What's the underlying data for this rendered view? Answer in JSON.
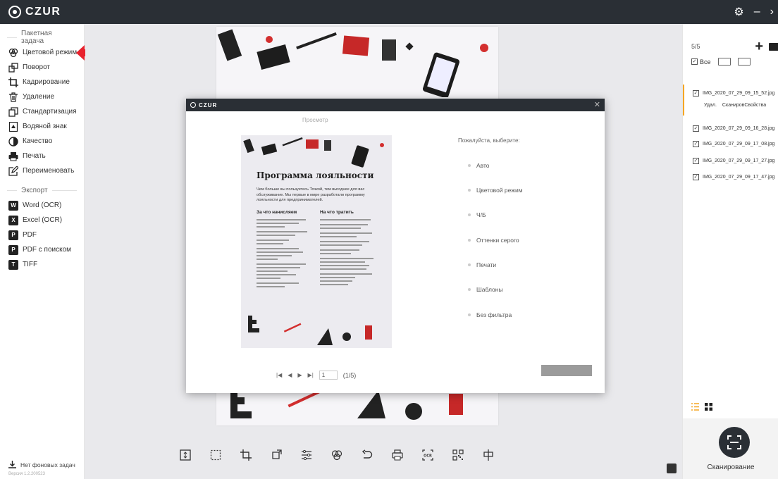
{
  "app": {
    "logo": "CZUR"
  },
  "sidebar": {
    "batch_header": "Пакетная задача",
    "batch_items": [
      {
        "label": "Цветовой режим",
        "icon": "color-mode-icon"
      },
      {
        "label": "Поворот",
        "icon": "rotate-icon"
      },
      {
        "label": "Кадрирование",
        "icon": "crop-icon"
      },
      {
        "label": "Удаление",
        "icon": "trash-icon"
      },
      {
        "label": "Стандартизация",
        "icon": "standardize-icon"
      },
      {
        "label": "Водяной знак",
        "icon": "watermark-icon"
      },
      {
        "label": "Качество",
        "icon": "quality-icon"
      },
      {
        "label": "Печать",
        "icon": "print-icon"
      },
      {
        "label": "Переименовать",
        "icon": "rename-icon"
      }
    ],
    "export_header": "Экспорт",
    "export_items": [
      {
        "label": "Word (OCR)",
        "icon": "word-icon",
        "badge": "W"
      },
      {
        "label": "Excel (OCR)",
        "icon": "excel-icon",
        "badge": "X"
      },
      {
        "label": "PDF",
        "icon": "pdf-icon",
        "badge": "P"
      },
      {
        "label": "PDF с поиском",
        "icon": "pdf-search-icon",
        "badge": "P"
      },
      {
        "label": "TIFF",
        "icon": "tiff-icon",
        "badge": "T"
      }
    ],
    "background_tasks": "Нет фоновых задач",
    "version": "Версия 1.2.200523"
  },
  "right_panel": {
    "count": "5/5",
    "select_all": "Все",
    "files": [
      "IMG_2020_07_29_09_15_52.jpg",
      "IMG_2020_07_29_09_16_28.jpg",
      "IMG_2020_07_29_09_17_08.jpg",
      "IMG_2020_07_29_09_17_27.jpg",
      "IMG_2020_07_29_09_17_47.jpg"
    ],
    "active_actions": [
      "Удал.",
      "Сканиров",
      "Свойства"
    ],
    "scan_label": "Сканирование"
  },
  "modal": {
    "logo": "CZUR",
    "preview_label": "Просмотр",
    "choose_label": "Пожалуйста, выберите:",
    "options": [
      "Авто",
      "Цветовой режим",
      "Ч/Б",
      "Оттенки серого",
      "Печати",
      "Шаблоны",
      "Без фильтра"
    ],
    "page_value": "1",
    "page_total": "(1/5)",
    "ok_label": ""
  },
  "preview_doc": {
    "title": "Программа лояльности",
    "lead": "Чем больше вы пользуетесь Точкой, тем выгоднее для вас обслуживание. Мы первые в мире разработали программу лояльности для предпринимателей.",
    "col1_title": "За что начисляем",
    "col2_title": "На что тратить"
  },
  "colors": {
    "titlebar": "#2a2f35",
    "accent_arrow": "#e8222d",
    "active_file": "#f5a623"
  }
}
